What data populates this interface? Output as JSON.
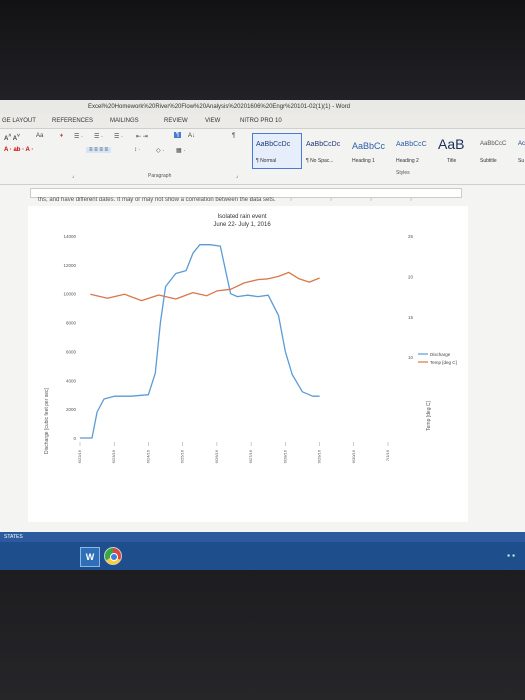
{
  "window": {
    "title": "Excel%20Homework%20River%20Flow%20Analysis%20201606%20Engr%20101-02(1)(1) - Word"
  },
  "tabs": [
    {
      "label": "GE LAYOUT"
    },
    {
      "label": "REFERENCES"
    },
    {
      "label": "MAILINGS"
    },
    {
      "label": "REVIEW"
    },
    {
      "label": "VIEW"
    },
    {
      "label": "NITRO PRO 10"
    }
  ],
  "ribbon": {
    "paragraph_label": "Paragraph",
    "styles_label": "Styles",
    "font_size_aa": "Aa",
    "styles": [
      {
        "sample": "AaBbCcDc",
        "name": "¶ Normal",
        "selected": true
      },
      {
        "sample": "AaBbCcDc",
        "name": "¶ No Spac...",
        "selected": false
      },
      {
        "sample": "AaBbCc",
        "name": "Heading 1",
        "selected": false
      },
      {
        "sample": "AaBbCcC",
        "name": "Heading 2",
        "selected": false
      },
      {
        "sample": "AaB",
        "name": "Title",
        "selected": false
      },
      {
        "sample": "AaBbCcC",
        "name": "Subtitle",
        "selected": false
      },
      {
        "sample": "Ac",
        "name": "Su",
        "selected": false
      }
    ]
  },
  "document": {
    "snippet": "ths, and have different dates. It may or may not show a correlation between the data sets."
  },
  "chart_data": {
    "type": "line",
    "title": "Isolated rain event",
    "subtitle": "June 22- July 1, 2016",
    "ylabel": "Discharge [cubic feet per sec]",
    "y2label": "Temp [deg C]",
    "ylim": [
      0,
      14000
    ],
    "yticks": [
      0,
      2000,
      4000,
      6000,
      8000,
      10000,
      12000,
      14000
    ],
    "y2lim": [
      0,
      25
    ],
    "y2ticks": [
      10,
      15,
      20,
      25
    ],
    "x_ticks": [
      "6/22/16",
      "6/23/16",
      "6/24/16",
      "6/25/16",
      "6/26/16",
      "6/27/16",
      "6/28/16",
      "6/29/16",
      "6/30/16",
      "7/1/16"
    ],
    "series": [
      {
        "name": "Discharge",
        "color": "#5b9bd5",
        "axis": "left",
        "x": [
          0,
          0.35,
          0.5,
          0.7,
          1.0,
          1.5,
          2.0,
          2.2,
          2.35,
          2.5,
          2.8,
          3.1,
          3.3,
          3.5,
          3.8,
          4.1,
          4.4,
          4.6,
          4.9,
          5.2,
          5.5,
          5.8,
          6.0,
          6.2,
          6.5,
          6.8,
          7.0
        ],
        "values": [
          0,
          0,
          1800,
          2700,
          2900,
          2900,
          3000,
          4500,
          8000,
          10500,
          11400,
          11600,
          12800,
          13400,
          13400,
          13300,
          10000,
          9800,
          9900,
          9800,
          9900,
          8500,
          6000,
          4400,
          3200,
          2900,
          2900
        ]
      },
      {
        "name": "Temp",
        "color": "#d9774b",
        "axis": "right",
        "x": [
          0.3,
          0.8,
          1.3,
          1.8,
          2.3,
          2.8,
          3.3,
          3.7,
          4.0,
          4.4,
          4.8,
          5.2,
          5.5,
          5.8,
          6.1,
          6.4,
          6.7,
          7.0
        ],
        "values": [
          17.8,
          17.3,
          17.8,
          17.0,
          17.7,
          17.2,
          18.0,
          17.6,
          18.2,
          18.4,
          19.2,
          19.6,
          19.7,
          20.0,
          20.5,
          19.7,
          19.3,
          19.8
        ]
      }
    ],
    "legend": {
      "position": "right",
      "entries": [
        "Discharge",
        "Temp [deg C]"
      ]
    }
  },
  "status": {
    "left": "STATES"
  },
  "taskbar": {
    "word_label": "W"
  },
  "colors": {
    "taskbar": "#1f4e8c",
    "accent": "#2b5a9e"
  }
}
